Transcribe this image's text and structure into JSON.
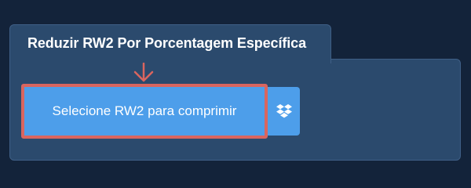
{
  "tab": {
    "title": "Reduzir RW2 Por Porcentagem Específica"
  },
  "upload": {
    "label": "Selecione RW2 para comprimir"
  },
  "icons": {
    "arrow": "arrow-down-icon",
    "dropbox": "dropbox-icon"
  },
  "colors": {
    "background": "#13233a",
    "panel": "#2b4a6d",
    "button": "#4d9eea",
    "highlight": "#d9655f"
  }
}
